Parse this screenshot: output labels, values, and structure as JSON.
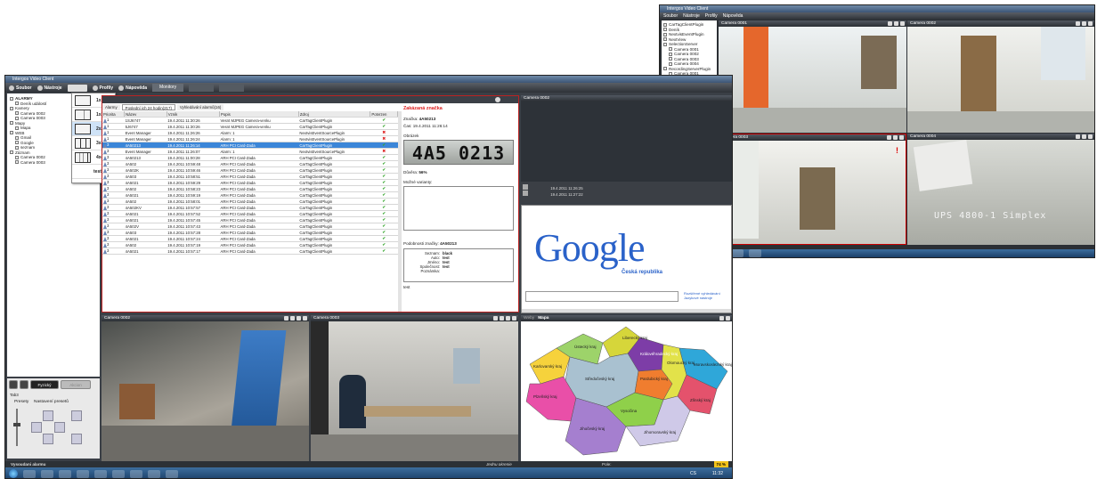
{
  "app": {
    "title": "Intergos Video Client",
    "status_left": "Vysoudani alarmu",
    "status_mid": "Jednu okrenie",
    "status_right": "Pole:",
    "zoom_badge": "74 %"
  },
  "menu": {
    "items": [
      "Soubor",
      "Nástroje",
      "Profily",
      "Nápověda",
      "Monitory"
    ]
  },
  "tree": {
    "items": [
      "ALARMY",
      "Deník událostí",
      "Kamery",
      "Camera 0002",
      "Camera 0003",
      "Mapy",
      "Mapa",
      "WEB",
      "Gmail",
      "Google",
      "seznam",
      "Záznam",
      "Camera 0002",
      "Camera 0003"
    ]
  },
  "layout_menu": {
    "items": [
      "1x1",
      "1x3",
      "2x2",
      "3x3",
      "4x4",
      "test"
    ]
  },
  "left_bottom": {
    "tab": "Fyzický",
    "tab2": "Akcion",
    "label": "Tab3",
    "presets": "Presety",
    "preset_settings": "Nastavení presetů"
  },
  "events": {
    "tabs": [
      "Alarmy",
      "Poslední ich 24 hodin(217)",
      "Vyhledávání alarmů(16)"
    ],
    "columns": [
      "Priorita",
      "Název",
      "Vznik",
      "Popis",
      "Zdroj",
      "Potvrzen"
    ],
    "rows": [
      {
        "p": "1",
        "name": "1SJ6747",
        "time": "19.4.2011 11:30:26",
        "desc": "Vesnt MJPEG Camera-venku",
        "src": "CarTagClientPlugin",
        "st": "ok",
        "sel": false
      },
      {
        "p": "1",
        "name": "5J6747",
        "time": "19.4.2011 11:30:26",
        "desc": "Vesnt MJPEG Camera-venku",
        "src": "CarTagClientPlugin",
        "st": "ok",
        "sel": false
      },
      {
        "p": "1",
        "name": "Event Manager",
        "time": "19.4.2011 11:26:26",
        "desc": "Alarm: 1",
        "src": "NextvisEventSourcePlugin",
        "st": "bad",
        "sel": false
      },
      {
        "p": "1",
        "name": "Event Manager",
        "time": "19.4.2011 11:26:24",
        "desc": "Alarm: 1",
        "src": "NextvisEventSourcePlugin",
        "st": "bad",
        "sel": false
      },
      {
        "p": "3",
        "name": "4A50213",
        "time": "19.4.2011 11:26:14",
        "desc": "ARH PCI Card-Zada",
        "src": "CarTagClientPlugin",
        "st": "ok",
        "sel": true
      },
      {
        "p": "3",
        "name": "Event Manager",
        "time": "19.4.2011 11:26:07",
        "desc": "Alarm: 1",
        "src": "NextvisEventSourcePlugin",
        "st": "bad",
        "sel": false
      },
      {
        "p": "3",
        "name": "4A50213",
        "time": "19.4.2011 11:00:28",
        "desc": "ARH PCI Card-Zada",
        "src": "CarTagClientPlugin",
        "st": "ok",
        "sel": false
      },
      {
        "p": "3",
        "name": "4A502",
        "time": "19.4.2011 10:59:48",
        "desc": "ARH PCI Card-Zada",
        "src": "CarTagClientPlugin",
        "st": "ok",
        "sel": false
      },
      {
        "p": "3",
        "name": "4A502K",
        "time": "19.4.2011 10:59:46",
        "desc": "ARH PCI Card-Zada",
        "src": "CarTagClientPlugin",
        "st": "ok",
        "sel": false
      },
      {
        "p": "3",
        "name": "4A503",
        "time": "19.4.2011 10:58:51",
        "desc": "ARH PCI Card-Zada",
        "src": "CarTagClientPlugin",
        "st": "ok",
        "sel": false
      },
      {
        "p": "3",
        "name": "4A5021",
        "time": "19.4.2011 10:59:29",
        "desc": "ARH PCI Card-Zada",
        "src": "CarTagClientPlugin",
        "st": "ok",
        "sel": false
      },
      {
        "p": "3",
        "name": "4A502",
        "time": "19.4.2011 10:58:23",
        "desc": "ARH PCI Card-Zada",
        "src": "CarTagClientPlugin",
        "st": "ok",
        "sel": false
      },
      {
        "p": "3",
        "name": "4A5021",
        "time": "19.4.2011 10:59:19",
        "desc": "ARH PCI Card-Zada",
        "src": "CarTagClientPlugin",
        "st": "ok",
        "sel": false
      },
      {
        "p": "3",
        "name": "4A502",
        "time": "19.4.2011 10:58:01",
        "desc": "ARH PCI Card-Zada",
        "src": "CarTagClientPlugin",
        "st": "ok",
        "sel": false
      },
      {
        "p": "3",
        "name": "4A502KV",
        "time": "19.4.2011 10:57:57",
        "desc": "ARH PCI Card-Zada",
        "src": "CarTagClientPlugin",
        "st": "ok",
        "sel": false
      },
      {
        "p": "3",
        "name": "4A5021",
        "time": "19.4.2011 10:57:52",
        "desc": "ARH PCI Card-Zada",
        "src": "CarTagClientPlugin",
        "st": "ok",
        "sel": false
      },
      {
        "p": "3",
        "name": "4A5021",
        "time": "19.4.2011 10:57:45",
        "desc": "ARH PCI Card-Zada",
        "src": "CarTagClientPlugin",
        "st": "ok",
        "sel": false
      },
      {
        "p": "3",
        "name": "4A502V",
        "time": "19.4.2011 10:57:43",
        "desc": "ARH PCI Card-Zada",
        "src": "CarTagClientPlugin",
        "st": "ok",
        "sel": false
      },
      {
        "p": "3",
        "name": "4A503",
        "time": "19.4.2011 10:57:28",
        "desc": "ARH PCI Card-Zada",
        "src": "CarTagClientPlugin",
        "st": "ok",
        "sel": false
      },
      {
        "p": "3",
        "name": "4A5021",
        "time": "19.4.2011 10:57:24",
        "desc": "ARH PCI Card-Zada",
        "src": "CarTagClientPlugin",
        "st": "ok",
        "sel": false
      },
      {
        "p": "3",
        "name": "4A502",
        "time": "19.4.2011 10:57:19",
        "desc": "ARH PCI Card-Zada",
        "src": "CarTagClientPlugin",
        "st": "ok",
        "sel": false
      },
      {
        "p": "3",
        "name": "4A5021",
        "time": "19.4.2011 10:57:17",
        "desc": "ARH PCI Card-Zada",
        "src": "CarTagClientPlugin",
        "st": "ok",
        "sel": false
      }
    ]
  },
  "detail": {
    "title": "Zakázaná značka",
    "plate_label": "Značka:",
    "plate": "4A50213",
    "time_label": "Čas:",
    "time": "19.4.2011 11:26:14",
    "image_label": "Obrázek",
    "plate_image": "4A5 0213",
    "conf_label": "Důvěra:",
    "conf": "56%",
    "variants_label": "Možné varianty:",
    "similar_label": "Podobnosti značky:",
    "similar": "4A50213",
    "owner_rows": [
      [
        "Seznam:",
        "black"
      ],
      [
        "Auto:",
        "test"
      ],
      [
        "Jméno:",
        "test"
      ],
      [
        "Společnost:",
        "test"
      ],
      [
        "Poznámka:",
        ""
      ]
    ],
    "footer": "test"
  },
  "camera_top": {
    "title": "Camera 0002",
    "time1": "19.4.2011 11:26:25",
    "time2": "19.4.2011 11:27:22"
  },
  "google": {
    "logo": "Google",
    "sub": "Česká republika",
    "link": "Rozšířené vyhledávání Jazykové nástroje"
  },
  "bottom": {
    "cam1": "Camera 0002",
    "cam2": "Camera 0003",
    "map_tab1": "Weby",
    "map_tab2": "Mapa"
  },
  "map": {
    "regions": [
      "Liberecký kraj",
      "Ústecký kraj",
      "Karlovarský kraj",
      "Královéhradecký kraj",
      "Pardubický kraj",
      "Středočeský kraj",
      "Plzeňský kraj",
      "Vysočina",
      "Jihočeský kraj",
      "Jihomoravský kraj",
      "Zlínský kraj",
      "Olomoucký kraj",
      "Moravskoslezský kraj"
    ]
  },
  "right_window": {
    "title": "Intergos Video Client",
    "menu": [
      "Soubor",
      "Nástroje",
      "Profily",
      "Nápověda"
    ],
    "cams": [
      "Camera 0001",
      "Camera 0002",
      "Camera 0003",
      "Camera 0004"
    ],
    "overlay": "UPS 4800-1 Simplex",
    "exclaim": "!",
    "btn1": "Nastavit",
    "btn2": "Smazat",
    "tab1": "Presety",
    "tab2": "Nastavení presetů",
    "bottom_tab": "Zvuky",
    "bottom_tab2": "Přední SK2"
  },
  "tray": {
    "lang": "CS",
    "time": "11:32"
  }
}
